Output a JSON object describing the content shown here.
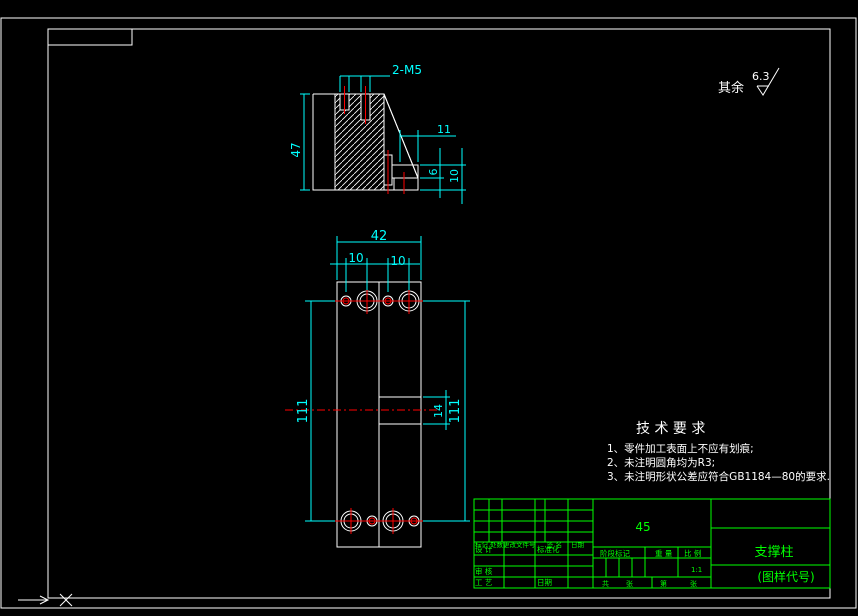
{
  "colors": {
    "background": "#000000",
    "frame": "#ffffff",
    "part_outline": "#ffffff",
    "dimension": "#00ffff",
    "title_block": "#00ff00",
    "centerline": "#ff0000"
  },
  "surface_finish": {
    "prefix": "其余",
    "value": "6.3"
  },
  "dimensions": {
    "thread": "2-M5",
    "height_47": "47",
    "width_11": "11",
    "d_6": "6",
    "d_10": "10",
    "width_42": "42",
    "left_10": "10",
    "right_10": "10",
    "length_111_left": "111",
    "length_111_right": "111",
    "slot_14": "14"
  },
  "tech_requirements": {
    "title": "技 术 要 求",
    "items": [
      "1、零件加工表面上不应有划痕;",
      "2、未注明圆角均为R3;",
      "3、未注明形状公差应符合GB1184—80的要求."
    ]
  },
  "title_block": {
    "material": "45",
    "part_name": "支撑柱",
    "drawing_number": "(图样代号)",
    "scale": "1:1",
    "labels": {
      "mark": "标记",
      "count": "处数",
      "zone": "分区",
      "change_doc": "更改文件号",
      "signature": "签 名",
      "date": "日期",
      "design": "设 计",
      "standardize": "标准化",
      "review": "审 核",
      "process": "工 艺",
      "approve": "批 准",
      "stage_mark": "阶段标记",
      "weight": "重 量",
      "ratio": "比 例",
      "total": "共",
      "sheet": "张",
      "page": "第",
      "page_unit": "张"
    }
  }
}
